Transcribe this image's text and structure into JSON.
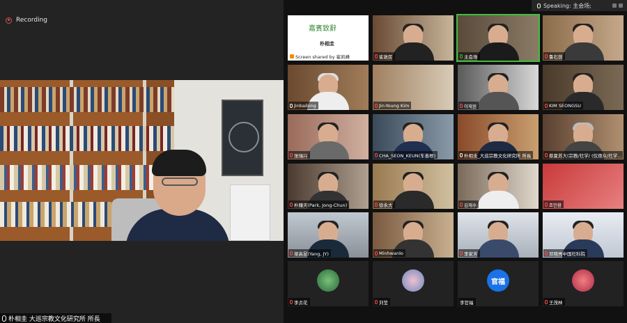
{
  "recording": {
    "label": "Recording"
  },
  "main_speaker": {
    "name": "朴相圭 大巡宗教文化研究所 所長"
  },
  "speaking": {
    "label": "Speaking: 主会场;"
  },
  "tiles": [
    {
      "name": "Screen shared by 崔凯峰",
      "slide_title": "嘉賓致辭",
      "slide_sub": "朴相圭"
    },
    {
      "name": "崔敦民"
    },
    {
      "name": "主会场"
    },
    {
      "name": "鲁石茵"
    },
    {
      "name": "Jinbailong"
    },
    {
      "name": "Jin-Young Kim"
    },
    {
      "name": "이재원"
    },
    {
      "name": "KIM SEONGSU"
    },
    {
      "name": "张瑞兴"
    },
    {
      "name": "CHA_SEON_KEUN(车善根)"
    },
    {
      "name": "朴相圭_大巡宗教文化研究所 所長"
    },
    {
      "name": "蔡夏苏大(宗教/社学/ (仅观众/社学..."
    },
    {
      "name": "朴鐘天(Park, Jong-Chun)"
    },
    {
      "name": "徐永大"
    },
    {
      "name": "김재수"
    },
    {
      "name": "조민환"
    },
    {
      "name": "梁高昆(Yang, JY)"
    },
    {
      "name": "Minhwanlo"
    },
    {
      "name": "李家芳"
    },
    {
      "name": "邓晓亮中国社科院"
    },
    {
      "name": "李贞花"
    },
    {
      "name": "刘莹"
    },
    {
      "name": "李官福",
      "initials": "官福"
    },
    {
      "name": "王茂林"
    }
  ]
}
